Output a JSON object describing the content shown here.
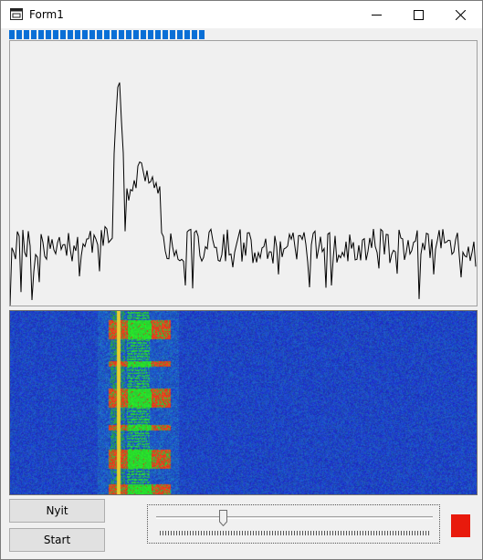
{
  "window": {
    "title": "Form1",
    "icons": {
      "app": "form-app-icon",
      "minimize": "minimize-icon",
      "maximize": "maximize-icon",
      "close": "close-icon"
    }
  },
  "progress": {
    "value": 0.42,
    "color": "#0a6fd6"
  },
  "buttons": {
    "open_label": "Nyit",
    "start_label": "Start"
  },
  "slider": {
    "value": 0.24
  },
  "indicator": {
    "color": "#e81a0c"
  },
  "colors": {
    "waterfall_bg": "#1b2fb6",
    "signal_red": "#e2312a",
    "signal_green": "#24d63a",
    "carrier_yellow": "#e8d030"
  }
}
